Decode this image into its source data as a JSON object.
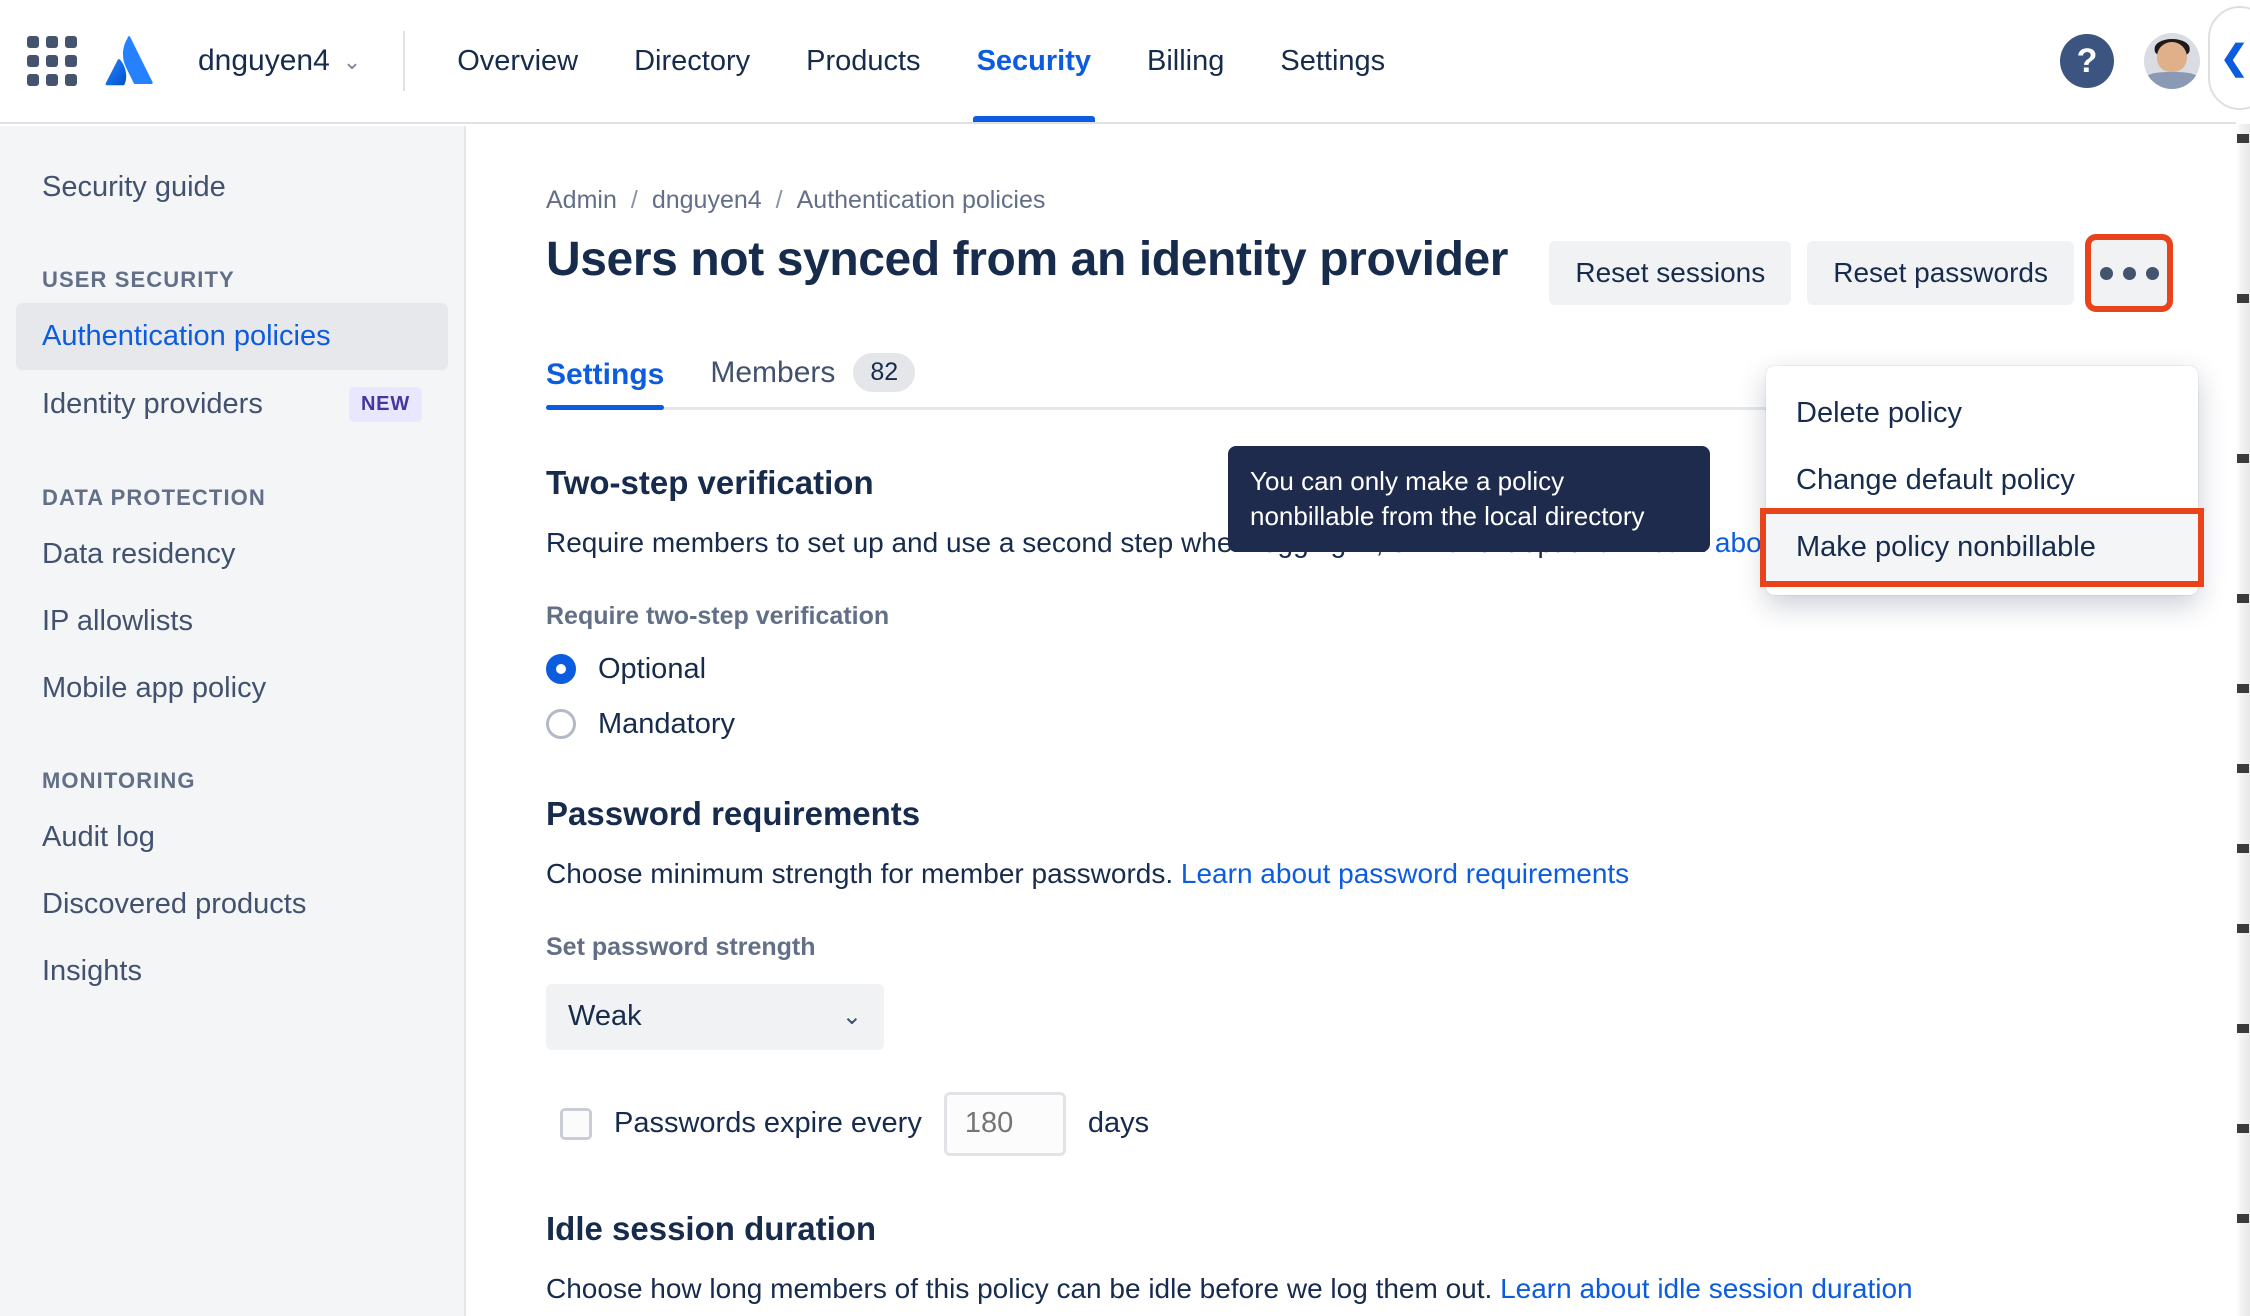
{
  "topnav": {
    "app_switcher_icon": "grid-apps-icon",
    "logo_icon": "atlassian-logo-icon",
    "site_name": "dnguyen4",
    "site_chevron": "⌄",
    "links": [
      {
        "label": "Overview",
        "active": false
      },
      {
        "label": "Directory",
        "active": false
      },
      {
        "label": "Products",
        "active": false
      },
      {
        "label": "Security",
        "active": true
      },
      {
        "label": "Billing",
        "active": false
      },
      {
        "label": "Settings",
        "active": false
      }
    ],
    "help_glyph": "?",
    "edge_glyph": "❮"
  },
  "sidebar": {
    "top_item": "Security guide",
    "groups": [
      {
        "title": "USER SECURITY",
        "items": [
          {
            "label": "Authentication policies",
            "selected": true,
            "badge": ""
          },
          {
            "label": "Identity providers",
            "selected": false,
            "badge": "NEW"
          }
        ]
      },
      {
        "title": "DATA PROTECTION",
        "items": [
          {
            "label": "Data residency",
            "selected": false,
            "badge": ""
          },
          {
            "label": "IP allowlists",
            "selected": false,
            "badge": ""
          },
          {
            "label": "Mobile app policy",
            "selected": false,
            "badge": ""
          }
        ]
      },
      {
        "title": "MONITORING",
        "items": [
          {
            "label": "Audit log",
            "selected": false,
            "badge": ""
          },
          {
            "label": "Discovered products",
            "selected": false,
            "badge": ""
          },
          {
            "label": "Insights",
            "selected": false,
            "badge": ""
          }
        ]
      }
    ]
  },
  "breadcrumb": {
    "items": [
      "Admin",
      "dnguyen4",
      "Authentication policies"
    ],
    "separator": "/"
  },
  "page": {
    "title": "Users not synced from an identity provider"
  },
  "actions": {
    "reset_sessions": "Reset sessions",
    "reset_passwords": "Reset passwords",
    "more_icon": "more-horizontal-icon"
  },
  "menu": {
    "items": [
      {
        "label": "Delete policy",
        "highlighted": false
      },
      {
        "label": "Change default policy",
        "highlighted": false
      },
      {
        "label": "Make policy nonbillable",
        "highlighted": true
      }
    ]
  },
  "tooltip": {
    "text": "You can only make a policy nonbillable from the local directory"
  },
  "tabs": [
    {
      "label": "Settings",
      "count": "",
      "active": true
    },
    {
      "label": "Members",
      "count": "82",
      "active": false
    }
  ],
  "sections": {
    "two_step": {
      "heading": "Two-step verification",
      "description": "Require members to set up and use a second step when logging in, or make it optional.",
      "link": "Learn about two-step verification",
      "field_label": "Require two-step verification",
      "options": [
        {
          "label": "Optional",
          "checked": true
        },
        {
          "label": "Mandatory",
          "checked": false
        }
      ]
    },
    "password": {
      "heading": "Password requirements",
      "description": "Choose minimum strength for member passwords.",
      "link": "Learn about password requirements",
      "field_label": "Set password strength",
      "strength_value": "Weak",
      "strength_chevron": "⌄",
      "expire_label": "Passwords expire every",
      "expire_placeholder": "180",
      "expire_value": "",
      "days_label": "days"
    },
    "idle": {
      "heading": "Idle session duration",
      "description": "Choose how long members of this policy can be idle before we log them out.",
      "link": "Learn about idle session duration"
    }
  },
  "colors": {
    "accent": "#0c5ce0",
    "text": "#172b4d",
    "subtle": "#626f86",
    "highlight_red": "#e8431b",
    "tooltip_bg": "#1e2b4d",
    "sidebar_bg": "#f4f5f7"
  }
}
